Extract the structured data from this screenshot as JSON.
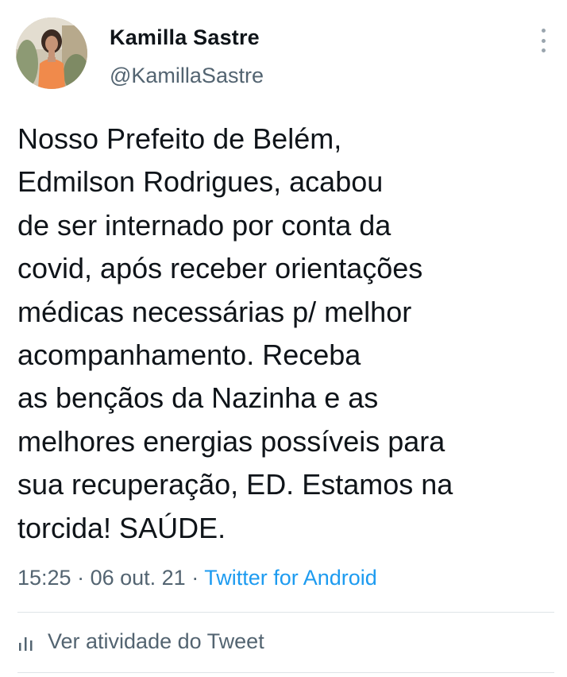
{
  "author": {
    "name": "Kamilla Sastre",
    "handle": "@KamillaSastre"
  },
  "tweet": {
    "lines": [
      "Nosso Prefeito de Belém,",
      "Edmilson Rodrigues, acabou",
      "de ser internado por conta da",
      "covid, após receber orientações",
      "médicas necessárias p/  melhor",
      "acompanhamento. Receba",
      "as bençãos da Nazinha e as",
      "melhores energias possíveis para",
      "sua recuperação, ED. Estamos na",
      "torcida! SAÚDE."
    ]
  },
  "meta": {
    "time": "15:25",
    "separator": " · ",
    "date": "06 out. 21",
    "source": "Twitter for Android"
  },
  "activity": {
    "label": "Ver atividade do Tweet",
    "icon": "analytics-bars-icon"
  },
  "menu": {
    "icon": "more-vertical-icon"
  },
  "colors": {
    "text": "#0f1419",
    "secondary": "#536471",
    "link": "#1d9bf0",
    "divider": "#dfe4e8"
  }
}
